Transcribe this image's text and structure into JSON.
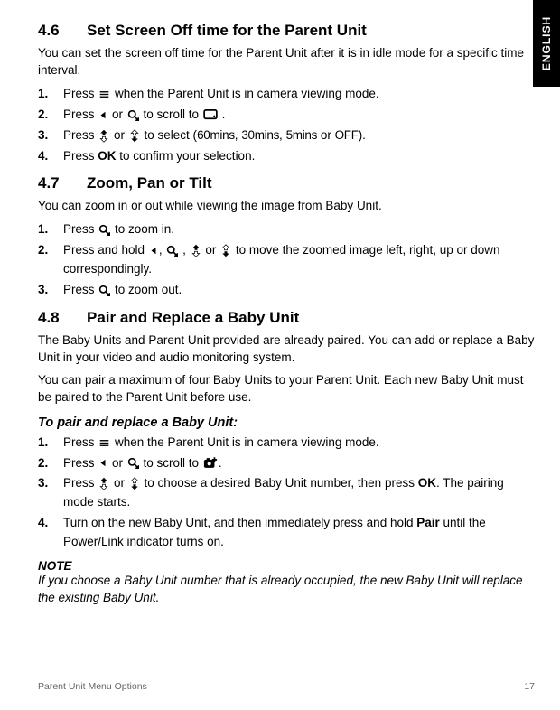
{
  "lang_tab": "ENGLISH",
  "sec46": {
    "num": "4.6",
    "title": "Set Screen Off time for the Parent Unit",
    "intro": "You can set the screen off time for the Parent Unit after it is in idle mode for a specific time interval.",
    "s1a": "Press ",
    "s1b": " when the Parent Unit is in camera viewing mode.",
    "s2a": "Press ",
    "s2b": " or  ",
    "s2c": "  to scroll to ",
    "s2d": " .",
    "s3a": "Press  ",
    "s3b": "  or  ",
    "s3c": "  to select (",
    "opt1": "60mins",
    "comma1": ", ",
    "opt2": "30mins",
    "comma2": ", ",
    "opt3": "5mins",
    "or": " or ",
    "opt4": "OFF",
    "s3d": ").",
    "s4a": "Press ",
    "ok": "OK",
    "s4b": " to confirm your selection."
  },
  "sec47": {
    "num": "4.7",
    "title": "Zoom, Pan or Tilt",
    "intro": "You can zoom in or out while viewing the image from Baby Unit.",
    "s1a": "Press  ",
    "s1b": "  to zoom in.",
    "s2a": "Press and hold ",
    "s2b": ",  ",
    "s2c": " ,  ",
    "s2d": " or  ",
    "s2e": "  to move the zoomed image left, right, up or down correspondingly.",
    "s3a": "Press  ",
    "s3b": "  to zoom out."
  },
  "sec48": {
    "num": "4.8",
    "title": "Pair and Replace a Baby Unit",
    "p1": " The Baby Units and Parent Unit provided are already paired. You can add or replace a Baby Unit in your video and audio monitoring system.",
    "p2": "You can pair a maximum of four Baby Units to your Parent Unit. Each new Baby Unit must be paired to the Parent Unit before use.",
    "subhead": "To pair and replace a Baby Unit:",
    "s1a": "Press ",
    "s1b": " when the Parent Unit is in camera viewing mode.",
    "s2a": "Press ",
    "s2b": " or  ",
    "s2c": "  to scroll to ",
    "s2d": ".",
    "s3a": "Press  ",
    "s3b": "  or  ",
    "s3c": "  to choose a desired Baby Unit number, then press ",
    "ok": "OK",
    "s3d": ". The pairing mode starts.",
    "s4a": "Turn on the new Baby Unit, and then immediately press and hold ",
    "pair": "Pair",
    "s4b": " until the Power/Link indicator turns on.",
    "notehead": "NOTE",
    "notebody": " If you choose a Baby Unit number that is already occupied, the new Baby Unit will replace the existing Baby Unit."
  },
  "footer_left": "Parent Unit Menu Options",
  "footer_right": "17"
}
